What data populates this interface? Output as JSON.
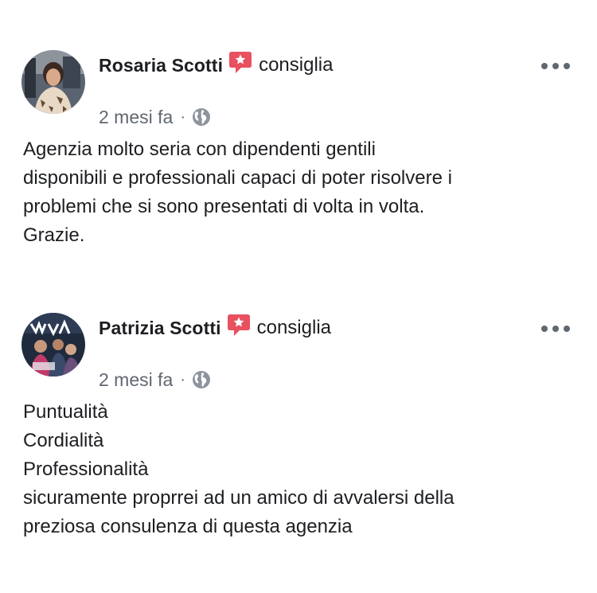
{
  "colors": {
    "text_primary": "#1c1e21",
    "text_secondary": "#606770",
    "recommend_badge": "#e8515f",
    "background": "#ffffff"
  },
  "icons": {
    "recommend": "recommend-speech-bubble-star-icon",
    "audience": "globe-icon",
    "more": "more-options-icon"
  },
  "reviews": [
    {
      "author": "Rosaria Scotti",
      "action": "consiglia",
      "timestamp": "2 mesi fa",
      "separator": "·",
      "text_lines": [
        "Agenzia molto seria con dipendenti gentili",
        "disponibili e professionali capaci di poter risolvere i",
        "problemi che si sono presentati di volta in volta.",
        "Grazie."
      ]
    },
    {
      "author": "Patrizia Scotti",
      "action": "consiglia",
      "timestamp": "2 mesi fa",
      "separator": "·",
      "text_lines": [
        "Puntualità",
        "Cordialità",
        "Professionalità",
        "sicuramente proprrei ad un amico di avvalersi della",
        "preziosa consulenza di questa agenzia"
      ]
    }
  ]
}
